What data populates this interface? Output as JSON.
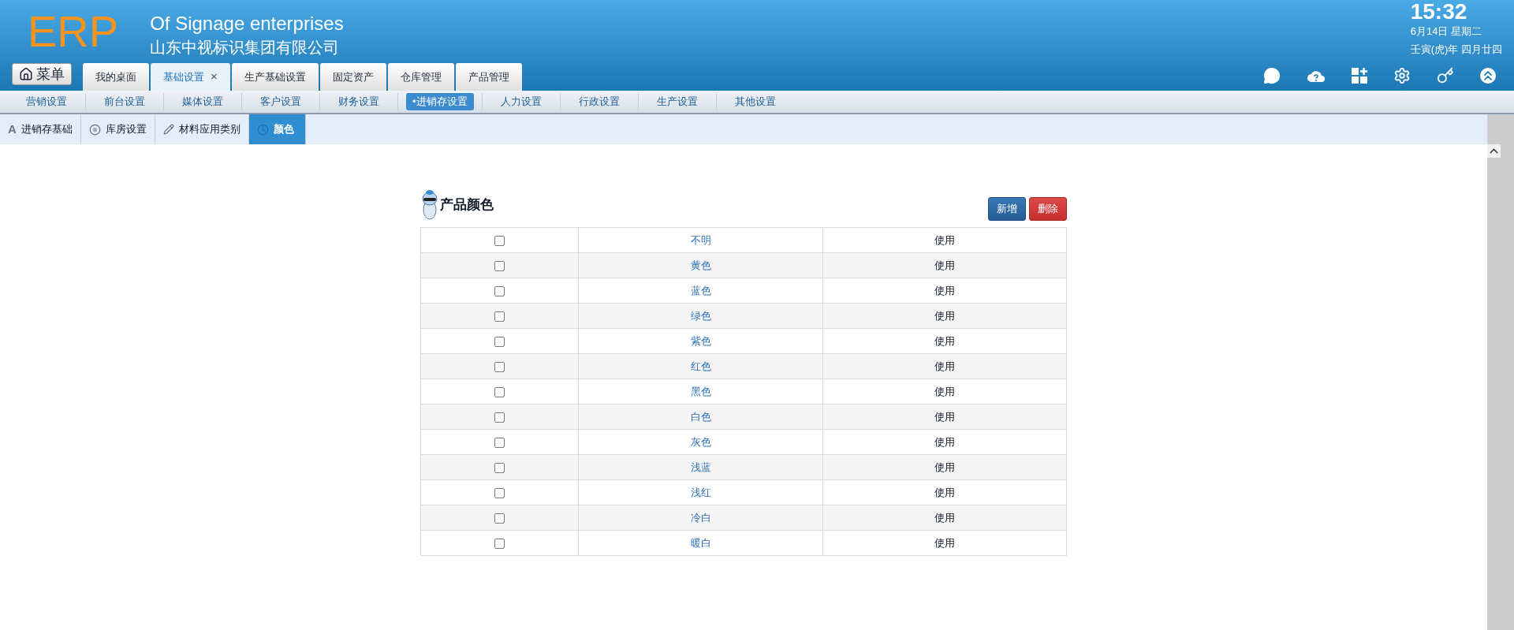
{
  "header": {
    "logo": "ERP",
    "company_en": "Of Signage enterprises",
    "company_cn": "山东中视标识集团有限公司",
    "time": "15:32",
    "date": "6月14日 星期二",
    "lunar": "壬寅(虎)年 四月廿四"
  },
  "menu_button": "菜单",
  "top_tabs": [
    {
      "label": "我的桌面",
      "selected": false,
      "closable": false
    },
    {
      "label": "基础设置",
      "selected": true,
      "closable": true,
      "close": "×"
    },
    {
      "label": "生产基础设置",
      "selected": false,
      "closable": false
    },
    {
      "label": "固定资产",
      "selected": false,
      "closable": false
    },
    {
      "label": "仓库管理",
      "selected": false,
      "closable": false
    },
    {
      "label": "产品管理",
      "selected": false,
      "closable": false
    }
  ],
  "subnav": [
    {
      "label": "营销设置",
      "selected": false
    },
    {
      "label": "前台设置",
      "selected": false
    },
    {
      "label": "媒体设置",
      "selected": false
    },
    {
      "label": "客户设置",
      "selected": false
    },
    {
      "label": "财务设置",
      "selected": false
    },
    {
      "label": "•进销存设置",
      "selected": true
    },
    {
      "label": "人力设置",
      "selected": false
    },
    {
      "label": "行政设置",
      "selected": false
    },
    {
      "label": "生产设置",
      "selected": false
    },
    {
      "label": "其他设置",
      "selected": false
    }
  ],
  "section_tabs": [
    {
      "label": "进销存基础",
      "selected": false,
      "kind": "letter",
      "glyph": "A"
    },
    {
      "label": "库房设置",
      "selected": false,
      "kind": "pause"
    },
    {
      "label": "材料应用类别",
      "selected": false,
      "kind": "brush"
    },
    {
      "label": "颜色",
      "selected": true,
      "kind": "clock"
    }
  ],
  "panel": {
    "title": "产品颜色",
    "buttons": [
      {
        "label": "新增",
        "kind": "primary"
      },
      {
        "label": "删除",
        "kind": "danger"
      }
    ],
    "rows": [
      {
        "checked": false,
        "name": "不明",
        "status": "使用"
      },
      {
        "checked": false,
        "name": "黄色",
        "status": "使用"
      },
      {
        "checked": false,
        "name": "蓝色",
        "status": "使用"
      },
      {
        "checked": false,
        "name": "绿色",
        "status": "使用"
      },
      {
        "checked": false,
        "name": "紫色",
        "status": "使用"
      },
      {
        "checked": false,
        "name": "红色",
        "status": "使用"
      },
      {
        "checked": false,
        "name": "黑色",
        "status": "使用"
      },
      {
        "checked": false,
        "name": "白色",
        "status": "使用"
      },
      {
        "checked": false,
        "name": "灰色",
        "status": "使用"
      },
      {
        "checked": false,
        "name": "浅蓝",
        "status": "使用"
      },
      {
        "checked": false,
        "name": "浅红",
        "status": "使用"
      },
      {
        "checked": false,
        "name": "冷白",
        "status": "使用"
      },
      {
        "checked": false,
        "name": "暖白",
        "status": "使用"
      }
    ]
  }
}
